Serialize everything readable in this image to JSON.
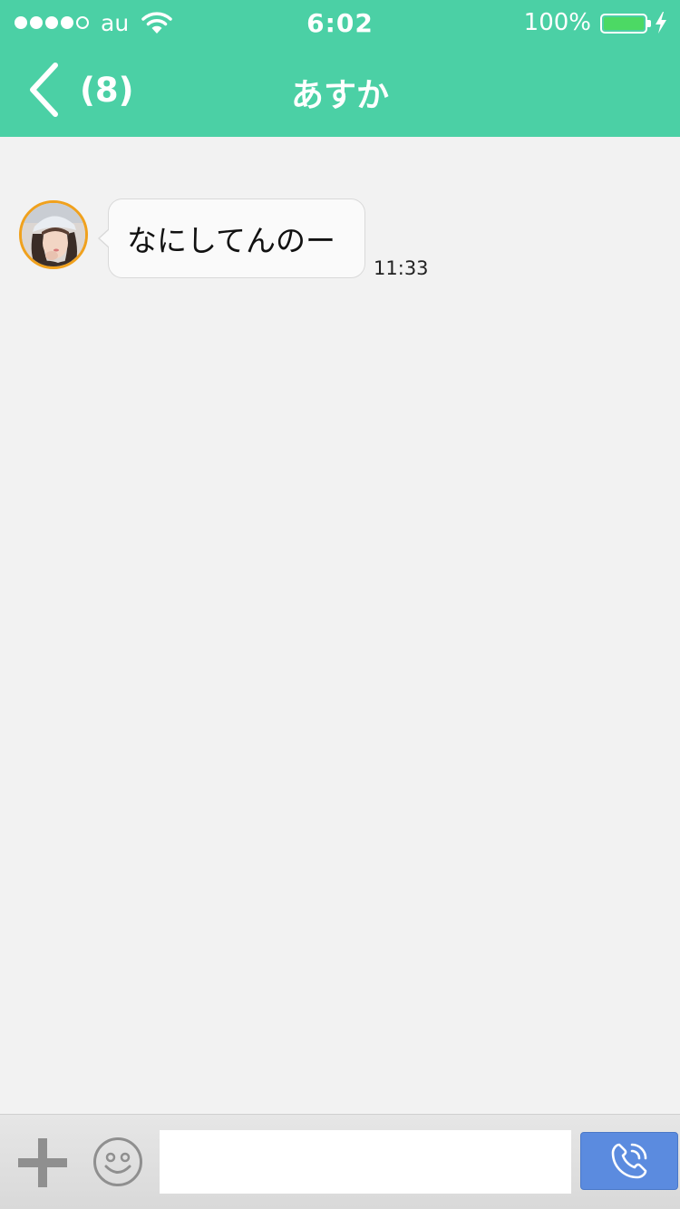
{
  "status_bar": {
    "carrier": "au",
    "time": "6:02",
    "battery": "100%",
    "signal_bars_filled": 4,
    "signal_bars_total": 5
  },
  "nav": {
    "back_icon": "chevron-left-icon",
    "unread_count": "(8)",
    "title": "あすか"
  },
  "messages": [
    {
      "sender": "incoming",
      "text": "なにしてんのー",
      "time": "11:33"
    }
  ],
  "input_bar": {
    "add_icon": "plus-icon",
    "emoji_icon": "smiley-icon",
    "message_value": "",
    "call_icon": "phone-icon"
  },
  "colors": {
    "header": "#4bd0a5",
    "background": "#f2f2f2",
    "call_button": "#5b8bdf",
    "avatar_ring": "#f0a11d",
    "battery_fill": "#4cd964"
  }
}
